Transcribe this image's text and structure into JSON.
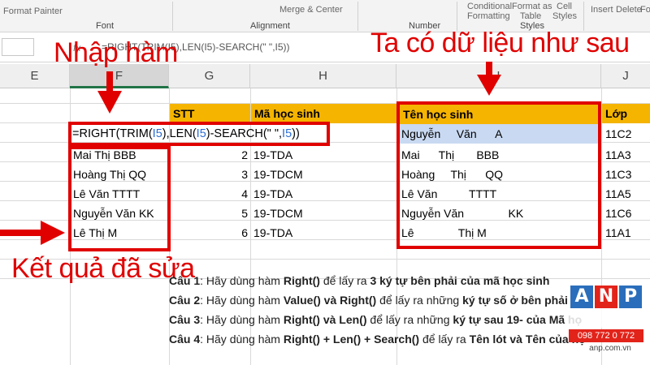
{
  "ribbon": {
    "painter": "Format Painter",
    "font_group": "Font",
    "alignment_group": "Alignment",
    "number_group": "Number",
    "styles_group": "Styles",
    "merge": "Merge & Center",
    "cond": "Conditional",
    "formatting": "Formatting",
    "format_as": "Format as",
    "table": "Table",
    "cell": "Cell",
    "styles": "Styles",
    "insert": "Insert",
    "delete": "Delete",
    "format": "Form"
  },
  "formula_bar": {
    "fx": "fx",
    "formula": "=RIGHT(TRIM(I5),LEN(I5)-SEARCH(\" \",I5))"
  },
  "columns": {
    "E": "E",
    "F": "F",
    "G": "G",
    "H": "H",
    "I": "I",
    "J": "J"
  },
  "headers": {
    "stt": "STT",
    "ma_hoc_sinh": "Mã học sinh",
    "ten_hoc_sinh": "Tên học sinh",
    "lop": "Lớp"
  },
  "editing_formula": {
    "p1": "=RIGHT(TRIM(",
    "r1": "I5",
    "p2": "),LEN(",
    "r2": "I5",
    "p3": ")-SEARCH(\" \",",
    "r3": "I5",
    "p4": "))"
  },
  "results": [
    "Mai Thị BBB",
    "Hoàng Thị QQ",
    "Lê Văn TTTT",
    "Nguyễn Văn KK",
    "Lê Thị M"
  ],
  "stt": [
    "2",
    "3",
    "4",
    "5",
    "6"
  ],
  "ma": [
    "19-TDA",
    "19-TDCM",
    "19-TDA",
    "19-TDCM",
    "19-TDA"
  ],
  "ten": [
    "Nguyễn     Văn      A",
    "Mai      Thị       BBB",
    "Hoàng     Thị      QQ",
    "Lê Văn          TTTT",
    "Nguyễn Văn              KK",
    "Lê              Thị M"
  ],
  "lop": [
    "11C2",
    "11A3",
    "11C3",
    "11A5",
    "11C6",
    "11A1"
  ],
  "labels": {
    "nhap_ham": "Nhập hàm",
    "ta_co": "Ta có dữ liệu như sau",
    "ket_qua": "Kết quả đã sửa"
  },
  "questions": [
    {
      "label": "Câu 1",
      "text": ": Hãy dùng hàm ",
      "fn": "Right()",
      "rest": " để lấy ra ",
      "bold2": "3 ký tự bên phải của mã học sinh",
      "tail": ""
    },
    {
      "label": "Câu 2",
      "text": ": Hãy dùng hàm ",
      "fn": "Value() và Right()",
      "rest": " để lấy ra những ",
      "bold2": "ký tự số ở bên phải củ",
      "tail": ""
    },
    {
      "label": "Câu 3",
      "text": ": Hãy dùng hàm ",
      "fn": "Right() và Len()",
      "rest": " để lấy ra  những ",
      "bold2": "ký tự sau 19- của Mã họ",
      "tail": ""
    },
    {
      "label": "Câu 4",
      "text": ": Hãy dùng hàm ",
      "fn": "Right() + Len() + Search()",
      "rest": " để lấy ra ",
      "bold2": "Tên lót và Tên của họ",
      "tail": ""
    }
  ],
  "logo": {
    "a": "A",
    "n": "N",
    "p": "P",
    "phone": "098 772 0 772",
    "web": "anp.com.vn"
  },
  "colors": {
    "accent_red": "#e00000",
    "header_yellow": "#f5b400",
    "selection_blue": "#c9d9f1",
    "ref_blue": "#2b6cd4"
  }
}
